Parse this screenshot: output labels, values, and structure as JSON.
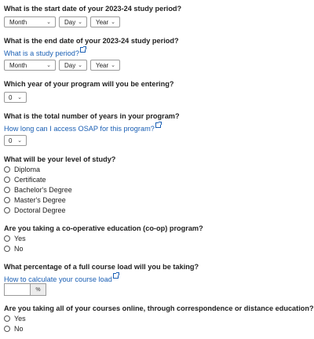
{
  "start_date": {
    "question": "What is the start date of your 2023-24 study period?",
    "month": "Month",
    "day": "Day",
    "year": "Year"
  },
  "end_date": {
    "question": "What is the end date of your 2023-24 study period?",
    "help_link": "What is a study period?",
    "month": "Month",
    "day": "Day",
    "year": "Year"
  },
  "program_year": {
    "question": "Which year of your program will you be entering?",
    "value": "0"
  },
  "total_years": {
    "question": "What is the total number of years in your program?",
    "help_link": "How long can I access OSAP for this program?",
    "value": "0"
  },
  "level_of_study": {
    "question": "What will be your level of study?",
    "options": [
      "Diploma",
      "Certificate",
      "Bachelor's Degree",
      "Master's Degree",
      "Doctoral Degree"
    ]
  },
  "coop": {
    "question": "Are you taking a co-operative education (co-op) program?",
    "options": [
      "Yes",
      "No"
    ]
  },
  "course_load": {
    "question": "What percentage of a full course load will you be taking?",
    "help_link": "How to calculate your course load",
    "unit": "%"
  },
  "online": {
    "question": "Are you taking all of your courses online, through correspondence or distance education?",
    "options": [
      "Yes",
      "No"
    ]
  }
}
